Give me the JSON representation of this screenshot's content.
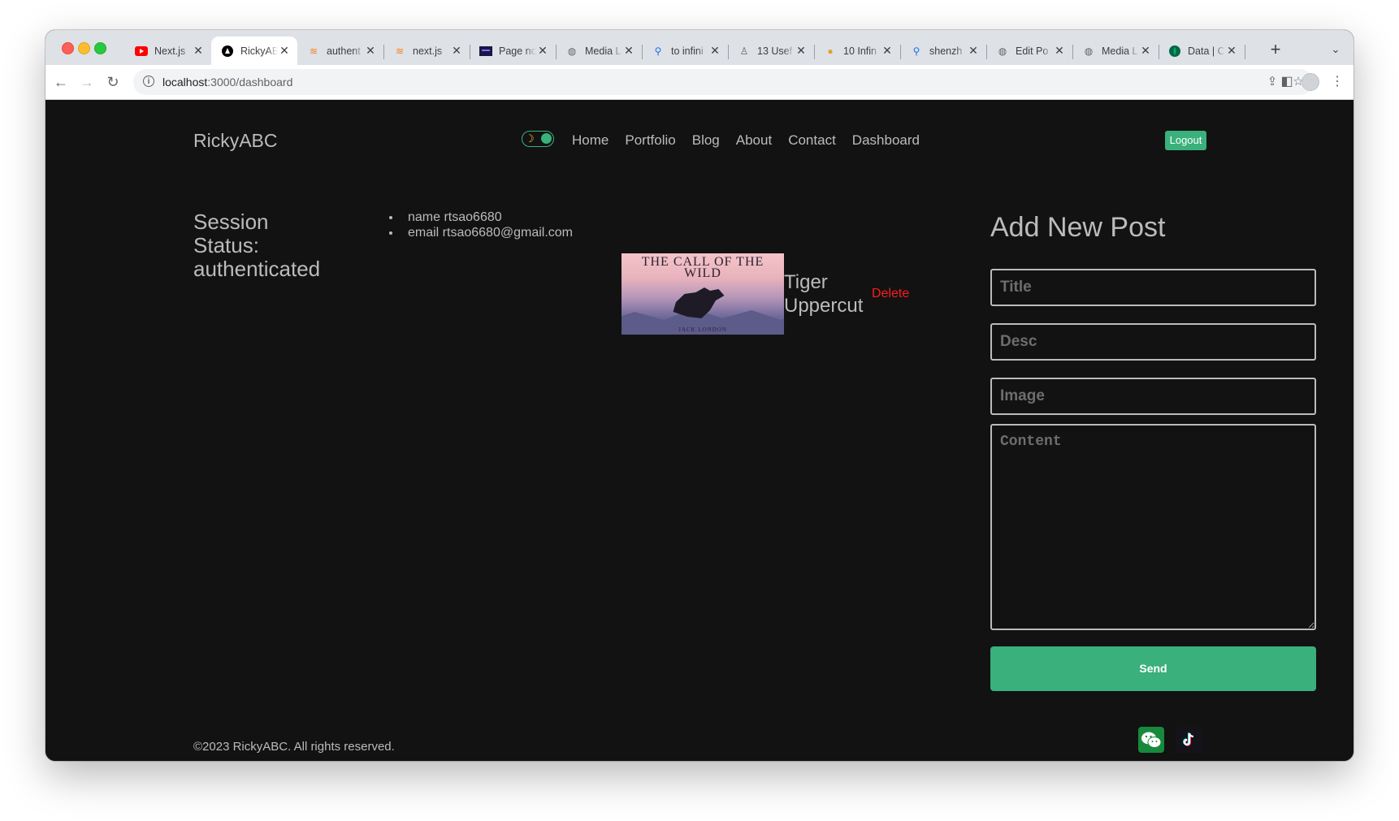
{
  "browser": {
    "tabs": [
      {
        "label": "Next.js",
        "icon": "youtube-icon",
        "active": false
      },
      {
        "label": "RickyABC",
        "icon": "nextjs-icon",
        "active": true
      },
      {
        "label": "authent",
        "icon": "stackoverflow-icon",
        "active": false
      },
      {
        "label": "next.js",
        "icon": "stackoverflow-icon",
        "active": false
      },
      {
        "label": "Page nc",
        "icon": "page-icon",
        "active": false
      },
      {
        "label": "Media L",
        "icon": "globe-icon",
        "active": false
      },
      {
        "label": "to infini",
        "icon": "search-icon",
        "active": false
      },
      {
        "label": "13 Usef",
        "icon": "article-icon",
        "active": false
      },
      {
        "label": "10 Infin",
        "icon": "person-icon",
        "active": false
      },
      {
        "label": "shenzh",
        "icon": "search-icon",
        "active": false
      },
      {
        "label": "Edit Po",
        "icon": "globe-icon",
        "active": false
      },
      {
        "label": "Media L",
        "icon": "globe-icon",
        "active": false
      },
      {
        "label": "Data | C",
        "icon": "mongodb-icon",
        "active": false
      }
    ],
    "url_host": "localhost",
    "url_path": ":3000/dashboard"
  },
  "nav": {
    "logo": "RickyABC",
    "links": [
      "Home",
      "Portfolio",
      "Blog",
      "About",
      "Contact",
      "Dashboard"
    ],
    "logout_label": "Logout"
  },
  "session": {
    "status_text": "Session Status: authenticated",
    "name_item": "name rtsao6680",
    "email_item": "email rtsao6680@gmail.com"
  },
  "post": {
    "title": "Tiger Uppercut",
    "delete_label": "Delete",
    "image_title": "THE CALL OF THE WILD",
    "image_author": "JACK LONDON"
  },
  "form": {
    "heading": "Add New Post",
    "title_placeholder": "Title",
    "desc_placeholder": "Desc",
    "image_placeholder": "Image",
    "content_placeholder": "Content",
    "send_label": "Send"
  },
  "footer": {
    "copyright": "©2023 RickyABC. All rights reserved."
  },
  "colors": {
    "accent": "#3ab07c",
    "background": "#121212",
    "text": "#bbbbbb",
    "delete": "#ff1a1a"
  }
}
